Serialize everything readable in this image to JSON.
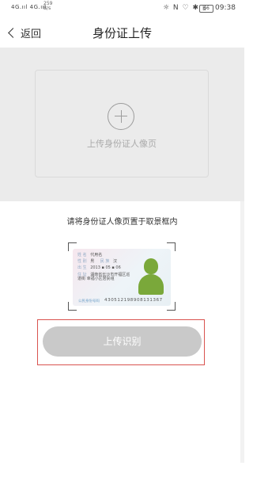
{
  "status_bar": {
    "signal": "4G.ııl 4G.ııl",
    "speed_value": "259",
    "speed_unit": "B/s",
    "icons": "☼ N ♡ ✱ ▯",
    "battery": "66",
    "time": "09:38"
  },
  "nav": {
    "back_label": "返回",
    "title": "身份证上传"
  },
  "upload": {
    "label": "上传身份证人像页"
  },
  "instruction": "请将身份证人像页置于取景框内",
  "sample_card": {
    "name_value": "代用名",
    "sex_value": "男",
    "ethnicity_value": "汉",
    "birth_value": "2013 ▪ 05 ▪ 06",
    "address_value": "湖南省长沙市开福区巡道街 幸福小区居民组",
    "id_number": "430512198908131367",
    "field_name": "姓 名",
    "field_sex": "性 别",
    "field_ethnicity": "民 族",
    "field_birth": "出 生",
    "field_address": "住 址",
    "field_id": "公民身份号码"
  },
  "button": {
    "label": "上传识别"
  }
}
